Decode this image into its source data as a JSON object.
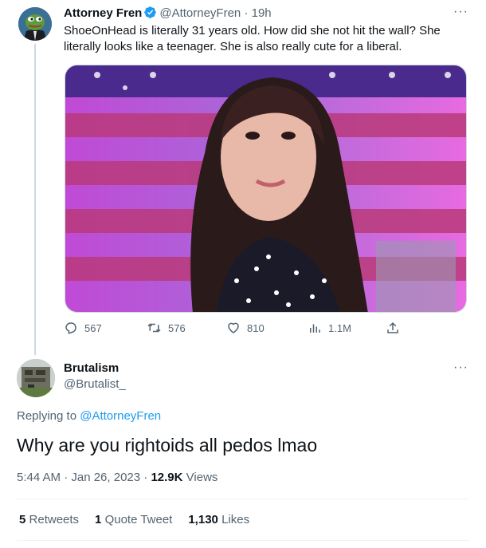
{
  "parent_tweet": {
    "author_name": "Attorney Fren",
    "handle": "@AttorneyFren",
    "time_sep": "·",
    "time": "19h",
    "more": "···",
    "text": "ShoeOnHead is literally 31 years old. How did she not hit the wall? She literally looks like a teenager. She is also really cute for a liberal.",
    "avatar": "pepe-frog-avatar",
    "media": "photo-woman-flag-background",
    "actions": {
      "replies": "567",
      "retweets": "576",
      "likes": "810",
      "views": "1.1M"
    }
  },
  "reply_tweet": {
    "author_name": "Brutalism",
    "handle": "@Brutalist_",
    "more": "···",
    "replying_prefix": "Replying to",
    "replying_to": "@AttorneyFren",
    "text": "Why are you rightoids all pedos lmao",
    "timestamp": "5:44 AM · Jan 26, 2023 ·",
    "views_count": "12.9K",
    "views_label": "Views",
    "stats": {
      "retweets_count": "5",
      "retweets_label": "Retweets",
      "quotes_count": "1",
      "quotes_label": "Quote Tweet",
      "likes_count": "1,130",
      "likes_label": "Likes"
    }
  },
  "colors": {
    "accent": "#1d9bf0",
    "secondary_text": "#536471",
    "primary_text": "#0f1419"
  }
}
